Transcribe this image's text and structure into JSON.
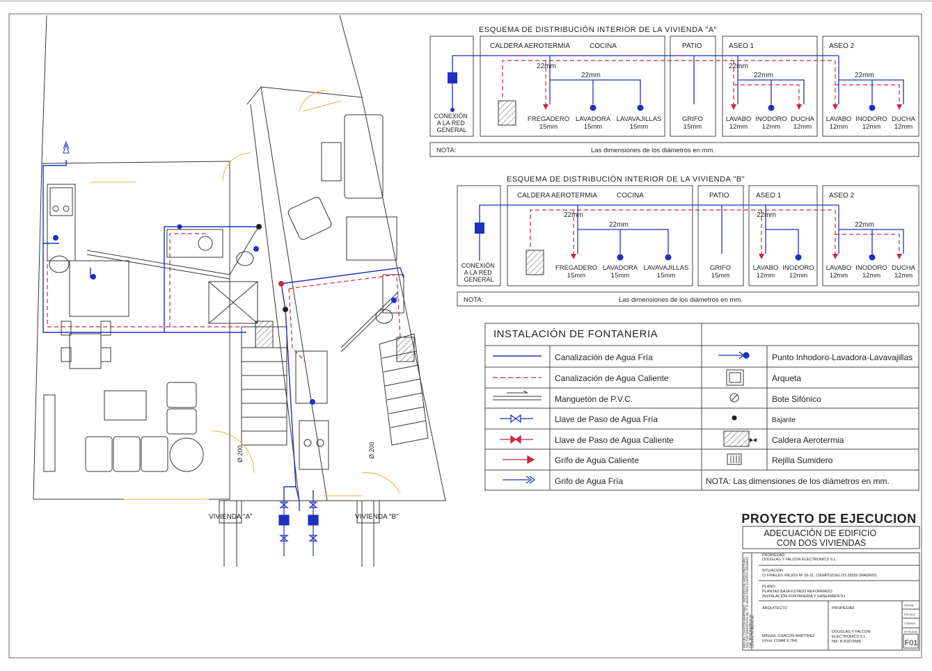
{
  "colors": {
    "cold_water": "#1f2fbf",
    "hot_water": "#d2233d",
    "walls": "#333333",
    "door_arcs": "#e3b23c",
    "paper": "#ffffff"
  },
  "schema_a": {
    "title": "ESQUEMA DE DISTRIBUCIÓN INTERIOR DE LA VIVIENDA \"A\"",
    "connection": [
      "CONEXIÓN",
      "A LA RED",
      "GENERAL"
    ],
    "sections": {
      "caldera": "CALDERA AEROTERMIA",
      "cocina": "COCINA",
      "patio": "PATIO",
      "aseo1": "ASEO 1",
      "aseo2": "ASEO 2"
    },
    "pipe_labels": [
      "22mm",
      "22mm",
      "22mm",
      "22mm",
      "22mm"
    ],
    "fixtures": [
      {
        "name": "FREGADERO",
        "size": "15mm"
      },
      {
        "name": "LAVADORA",
        "size": "15mm"
      },
      {
        "name": "LAVAVAJILLAS",
        "size": "15mm"
      },
      {
        "name": "GRIFO",
        "size": "15mm"
      },
      {
        "name": "LAVABO",
        "size": "12mm"
      },
      {
        "name": "INODORO",
        "size": "12mm"
      },
      {
        "name": "DUCHA",
        "size": "12mm"
      },
      {
        "name": "LAVABO",
        "size": "12mm"
      },
      {
        "name": "INODORO",
        "size": "12mm"
      },
      {
        "name": "DUCHA",
        "size": "12mm"
      }
    ],
    "note_label": "NOTA:",
    "note_text": "Las dimensiones de los diámetros en mm."
  },
  "schema_b": {
    "title": "ESQUEMA DE DISTRIBUCIÓN INTERIOR DE LA VIVIENDA \"B\"",
    "connection": [
      "CONEXIÓN",
      "A LA RED",
      "GENERAL"
    ],
    "sections": {
      "caldera": "CALDERA AEROTERMIA",
      "cocina": "COCINA",
      "patio": "PATIO",
      "aseo1": "ASEO 1",
      "aseo2": "ASEO 2"
    },
    "pipe_labels": [
      "22mm",
      "22mm",
      "22mm",
      "22mm"
    ],
    "fixtures": [
      {
        "name": "FREGADERO",
        "size": "15mm"
      },
      {
        "name": "LAVADORA",
        "size": "15mm"
      },
      {
        "name": "LAVAVAJILLAS",
        "size": "15mm"
      },
      {
        "name": "GRIFO",
        "size": "15mm"
      },
      {
        "name": "LAVABO",
        "size": "12mm"
      },
      {
        "name": "INODORO",
        "size": "12mm"
      },
      {
        "name": "LAVABO",
        "size": "12mm"
      },
      {
        "name": "INODORO",
        "size": "12mm"
      },
      {
        "name": "DUCHA",
        "size": "12mm"
      }
    ],
    "note_label": "NOTA:",
    "note_text": "Las dimensiones de los diámetros en mm."
  },
  "legend": {
    "title": "INSTALACIÓN DE FONTANERIA",
    "left": [
      {
        "icon": "cold-pipe-line-icon",
        "label": "Canalización de Agua Fría"
      },
      {
        "icon": "hot-pipe-line-icon",
        "label": "Canalización de Agua Caliente"
      },
      {
        "icon": "pvc-pipe-icon",
        "label": "Manguetón de P.V.C."
      },
      {
        "icon": "cold-valve-icon",
        "label": "Llave de Paso de Agua Fría"
      },
      {
        "icon": "hot-valve-icon",
        "label": "Llave de Paso de Agua Caliente"
      },
      {
        "icon": "hot-tap-icon",
        "label": "Grifo de Agua Caliente"
      },
      {
        "icon": "cold-tap-icon",
        "label": "Grifo de Agua Fría"
      }
    ],
    "right": [
      {
        "icon": "fixture-point-icon",
        "label": "Punto Inhodoro-Lavadora-Lavavajillas"
      },
      {
        "icon": "manhole-icon",
        "label": "Arqueta"
      },
      {
        "icon": "siphon-trap-icon",
        "label": "Bote Sifónico"
      },
      {
        "icon": "downpipe-icon",
        "label": "Bajante"
      },
      {
        "icon": "boiler-icon",
        "label": "Caldera Aerotermia"
      },
      {
        "icon": "drain-grate-icon",
        "label": "Rejilla Sumidero"
      }
    ],
    "note": "NOTA: Las dimensiones de los diámetros en mm."
  },
  "plan": {
    "vivienda_a": "VIVIENDA \"A\"",
    "vivienda_b": "VIVIENDA \"B\"",
    "pipe_diameter_1": "Ø 200",
    "pipe_diameter_2": "Ø 200"
  },
  "title_block": {
    "project": "PROYECTO DE EJECUCION",
    "subtitle": "ADECUACIÓN DE EDIFICIO CON DOS VIVIENDAS",
    "propiedad_label": "PROPIEDAD",
    "propiedad_value": "DOUGLAS Y FALCON ELECTRONICS S.L.",
    "situacion_label": "SITUACIÓN",
    "situacion_value": "C/ FRAILES VIEJOS Nº 29-31, CIEMPOZUELOS 28350 (MADRID)",
    "plano_label": "PLANO",
    "plano_value_1": "PLANTAS BAJA ESTADO REFORMADO",
    "plano_value_2": "INSTALACIÓN FONTANERÍA Y SANEAMIENTO",
    "arquitecto_label": "ARQUITECTO",
    "arquitecto_name": "MIGUEL CHACÓN MARTINEZ",
    "arquitecto_coam": "(nºcol. COAM 8.764)",
    "propiedad2_label": "PROPIEDAD",
    "propiedad2_value_1": "DOUGLAS Y FALCON",
    "propiedad2_value_2": "ELECTRONICS S.L.",
    "propiedad2_nif": "NIF: B-81670685",
    "side_text_1": "MIGUEL CHACÓN MARTINEZ - ESTUDIO DE ARQUITECTURA",
    "side_text_2": "SECTOR MINISTROS 3b, 7º D 28760 TRES CANTOS (MADRID)",
    "side_text_3": "mail: info@arquitecto.es",
    "side_text_4": "TLF/FAX: 91 803 61 50",
    "fecha_label": "FECHA",
    "escala_label": "ESCALA",
    "codigo_label": "CÓDIGO",
    "plano_no_label": "Nº PLANO",
    "plano_no": "F01"
  }
}
